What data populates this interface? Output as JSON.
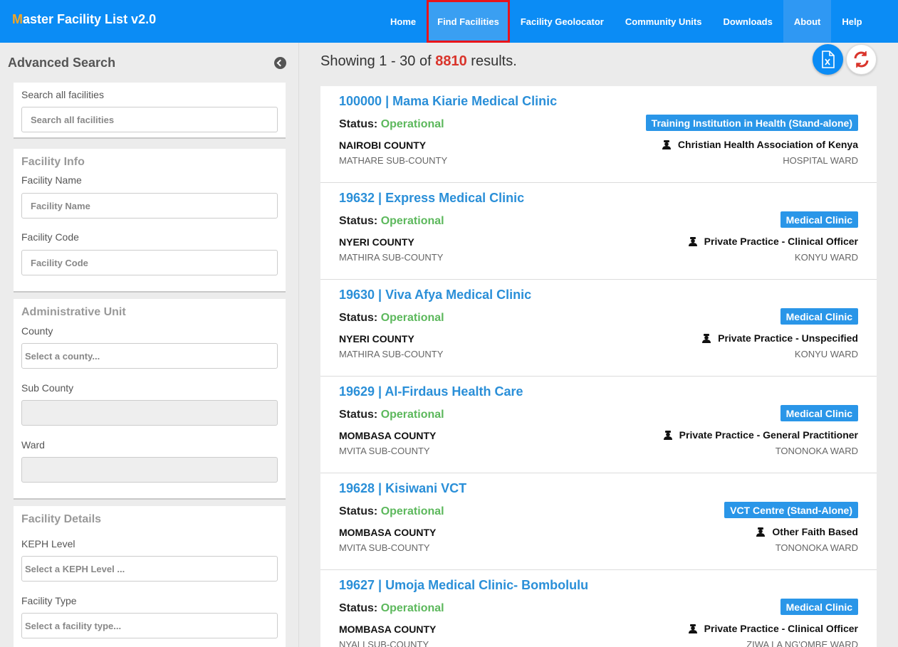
{
  "app": {
    "brand_first": "M",
    "brand_rest": "aster Facility List v2.0"
  },
  "nav": {
    "items": [
      {
        "label": "Home"
      },
      {
        "label": "Find Facilities"
      },
      {
        "label": "Facility Geolocator"
      },
      {
        "label": "Community Units"
      },
      {
        "label": "Downloads"
      },
      {
        "label": "About"
      },
      {
        "label": "Help"
      }
    ]
  },
  "sidebar": {
    "title": "Advanced Search",
    "search": {
      "label": "Search all facilities",
      "placeholder": "Search all facilities"
    },
    "facility_info": {
      "title": "Facility Info",
      "name_label": "Facility Name",
      "name_placeholder": "Facility Name",
      "code_label": "Facility Code",
      "code_placeholder": "Facility Code"
    },
    "admin_unit": {
      "title": "Administrative Unit",
      "county_label": "County",
      "county_placeholder": "Select a county...",
      "subcounty_label": "Sub County",
      "ward_label": "Ward"
    },
    "facility_details": {
      "title": "Facility Details",
      "keph_label": "KEPH Level",
      "keph_placeholder": "Select a KEPH Level ...",
      "type_label": "Facility Type",
      "type_placeholder": "Select a facility type..."
    }
  },
  "results": {
    "prefix": "Showing 1 - 30 of",
    "count": "8810",
    "suffix": "results.",
    "status_label": "Status:",
    "items": [
      {
        "title": "100000 | Mama Kiarie Medical Clinic",
        "status": "Operational",
        "county": "NAIROBI COUNTY",
        "subcounty": "MATHARE SUB-COUNTY",
        "type": "Training Institution in Health (Stand-alone)",
        "owner": "Christian Health Association of Kenya",
        "ward": "HOSPITAL WARD"
      },
      {
        "title": "19632 | Express Medical Clinic",
        "status": "Operational",
        "county": "NYERI COUNTY",
        "subcounty": "MATHIRA SUB-COUNTY",
        "type": "Medical Clinic",
        "owner": "Private Practice - Clinical Officer",
        "ward": "KONYU WARD"
      },
      {
        "title": "19630 | Viva Afya Medical Clinic",
        "status": "Operational",
        "county": "NYERI COUNTY",
        "subcounty": "MATHIRA SUB-COUNTY",
        "type": "Medical Clinic",
        "owner": "Private Practice - Unspecified",
        "ward": "KONYU WARD"
      },
      {
        "title": "19629 | Al-Firdaus Health Care",
        "status": "Operational",
        "county": "MOMBASA COUNTY",
        "subcounty": "MVITA SUB-COUNTY",
        "type": "Medical Clinic",
        "owner": "Private Practice - General Practitioner",
        "ward": "TONONOKA WARD"
      },
      {
        "title": "19628 | Kisiwani VCT",
        "status": "Operational",
        "county": "MOMBASA COUNTY",
        "subcounty": "MVITA SUB-COUNTY",
        "type": "VCT Centre (Stand-Alone)",
        "owner": "Other Faith Based",
        "ward": "TONONOKA WARD"
      },
      {
        "title": "19627 | Umoja Medical Clinic- Bombolulu",
        "status": "Operational",
        "county": "MOMBASA COUNTY",
        "subcounty": "NYALI SUB-COUNTY",
        "type": "Medical Clinic",
        "owner": "Private Practice - Clinical Officer",
        "ward": "ZIWA LA NG'OMBE WARD"
      }
    ]
  },
  "colors": {
    "navbar": "#0b8cf5",
    "brand_accent": "#f5a623",
    "active_outline": "#e8141b",
    "count_red": "#d9342b",
    "status_green": "#5cb85c",
    "badge_blue": "#2a96e8",
    "title_blue": "#2a8fd8"
  },
  "icons": {
    "collapse": "chevron-left-circle-icon",
    "export": "excel-file-icon",
    "refresh": "refresh-icon",
    "owner": "owner-icon"
  }
}
